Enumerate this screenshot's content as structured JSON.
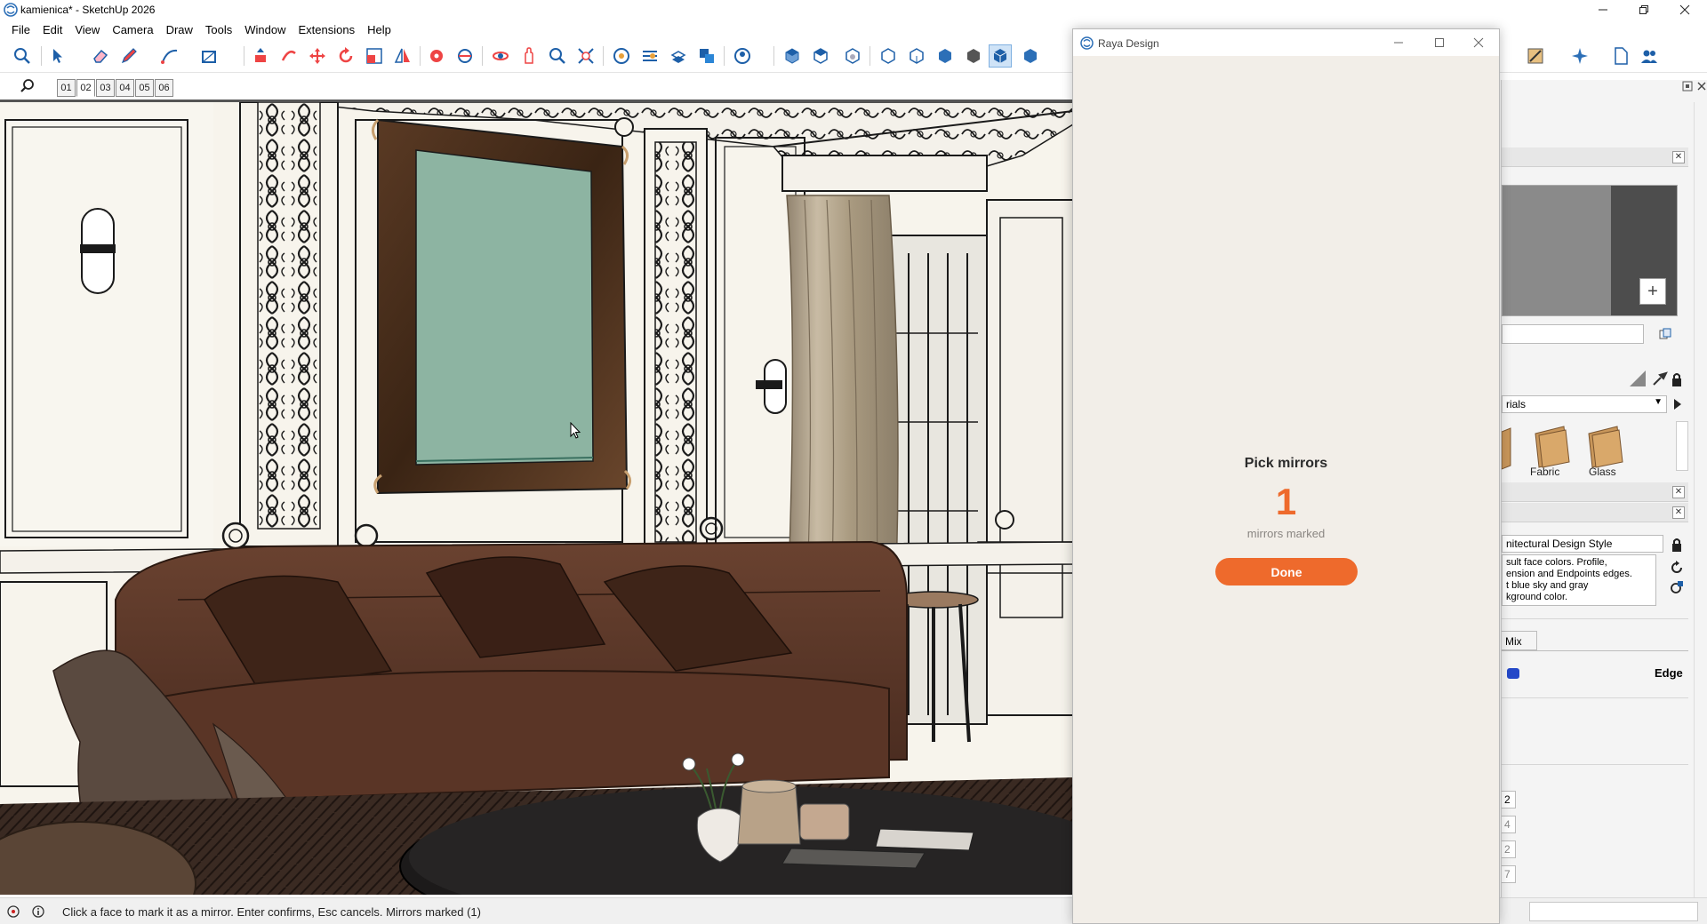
{
  "window": {
    "title": "kamienica* - SketchUp 2026",
    "app_icon": "sketchup-logo-icon"
  },
  "menu": {
    "items": [
      "File",
      "Edit",
      "View",
      "Camera",
      "Draw",
      "Tools",
      "Window",
      "Extensions",
      "Help"
    ]
  },
  "toolbar": {
    "icons": [
      "search-icon",
      "select-icon",
      "eraser-icon",
      "pencil-icon",
      "line-icon",
      "rectangle-icon",
      "push-pull-icon",
      "offset-icon",
      "move-icon",
      "rotate-icon",
      "scale-icon",
      "flip-icon",
      "tape-icon",
      "protractor-icon",
      "orbit-icon",
      "pan-icon",
      "zoom-icon",
      "zoom-extents-icon",
      "section-plane-icon",
      "section-fill-icon",
      "section-cut-icon",
      "component-icon",
      "iso-view-icon",
      "top-view-icon",
      "front-view-icon",
      "right-view-icon",
      "back-view-icon",
      "left-view-icon",
      "xray-icon",
      "shaded-icon",
      "textured-icon",
      "monochrome-icon"
    ]
  },
  "scenes": {
    "tabs": [
      "01",
      "02",
      "03",
      "04",
      "05",
      "06"
    ],
    "active": "02"
  },
  "status": {
    "text": "Click a face to mark it as a mirror. Enter confirms, Esc cancels. Mirrors marked (1)"
  },
  "raya": {
    "title": "Raya Design",
    "heading": "Pick mirrors",
    "count": "1",
    "count_label": "mirrors marked",
    "done_label": "Done",
    "accent": "#ee6a2c",
    "background": "#f2eee8"
  },
  "tray": {
    "materials_dropdown": "rials",
    "material_thumbs": [
      {
        "label": "Fabric"
      },
      {
        "label": "Glass"
      }
    ],
    "style_name": "nitectural Design Style",
    "style_description_lines": [
      "sult face colors. Profile,",
      "ension and Endpoints edges.",
      "t blue sky and gray",
      "kground color."
    ],
    "tab_mix": "Mix",
    "edge_label": "Edge",
    "numbers": [
      "2",
      "4",
      "2",
      "7"
    ]
  }
}
